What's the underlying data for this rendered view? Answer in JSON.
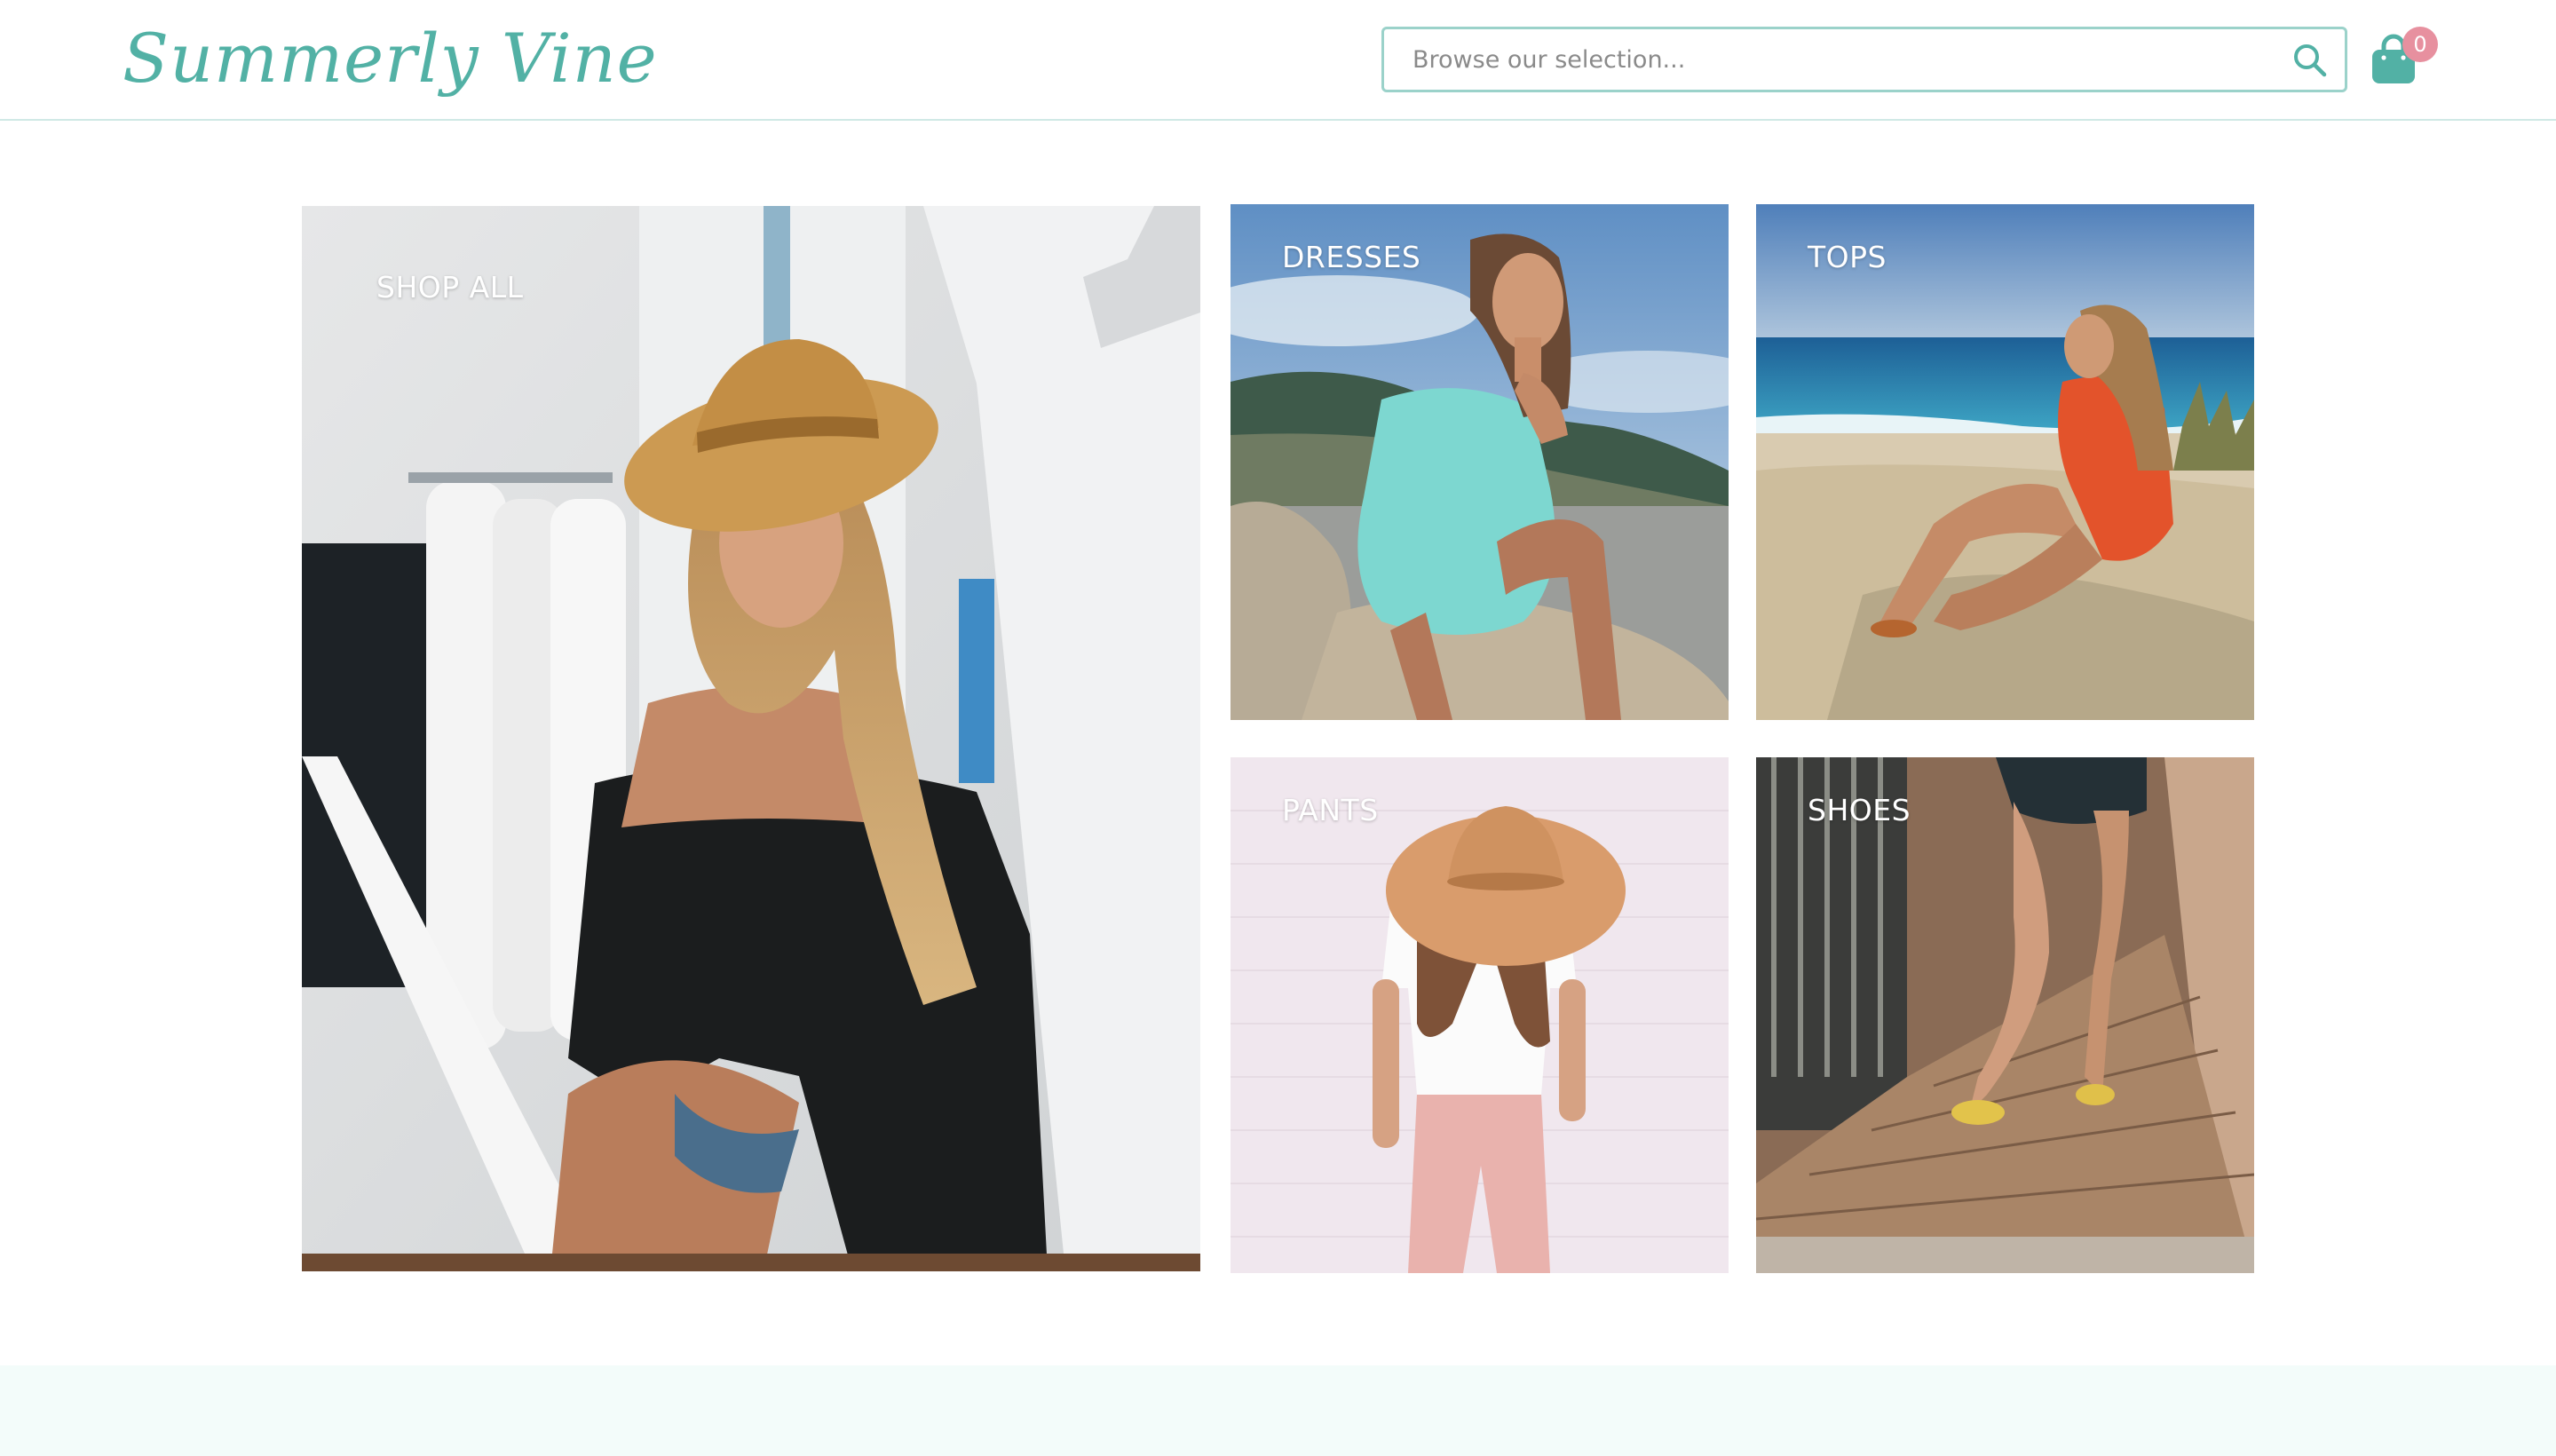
{
  "brand": {
    "name": "Summerly Vine",
    "color": "#52b1a5"
  },
  "search": {
    "placeholder": "Browse our selection...",
    "value": "",
    "icon": "search-icon"
  },
  "cart": {
    "icon": "shopping-bag-icon",
    "count": "0",
    "badge_color": "#e7909f"
  },
  "categories": [
    {
      "label": "SHOP ALL",
      "image": "woman-in-straw-hat-on-stairs"
    },
    {
      "label": "DRESSES",
      "image": "woman-in-mint-dress-on-rocks"
    },
    {
      "label": "TOPS",
      "image": "woman-in-orange-romper-on-beach"
    },
    {
      "label": "PANTS",
      "image": "woman-in-pink-pants-and-sun-hat"
    },
    {
      "label": "SHOES",
      "image": "woman-in-sandals-on-boardwalk"
    }
  ],
  "colors": {
    "accent": "#52b1a5",
    "header_border": "#cfe9e5",
    "footer_band": "#f3fcfa"
  }
}
